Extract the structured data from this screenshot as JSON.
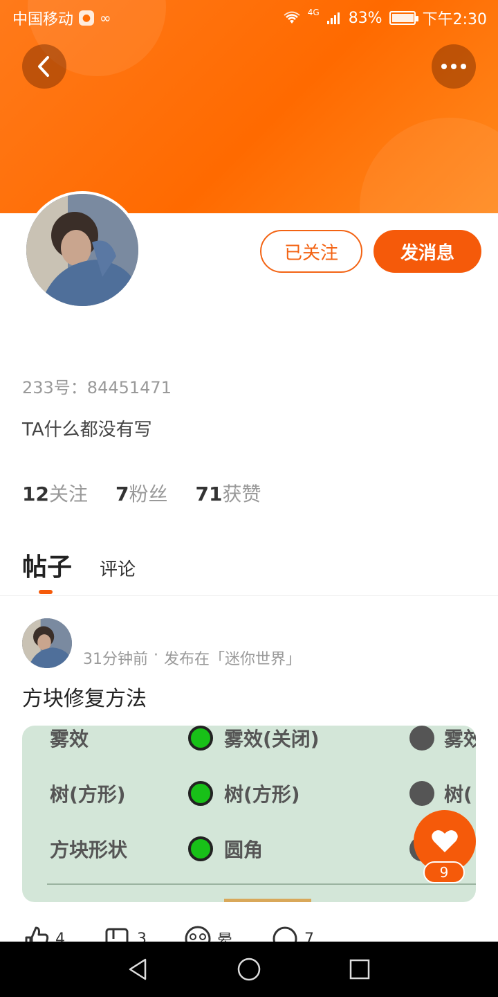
{
  "status_bar": {
    "carrier": "中国移动",
    "network": "4G",
    "battery": "83%",
    "time": "下午2:30",
    "battery_level": 0.83
  },
  "header": {
    "accent_color": "#ff6a00",
    "back_icon": "chevron-left-icon",
    "more_icon": "more-dots-icon"
  },
  "profile": {
    "follow_state_label": "已关注",
    "message_label": "发消息",
    "uid": "233号：84451471",
    "bio": "TA什么都没有写",
    "stats": [
      {
        "num": "12",
        "label": "关注"
      },
      {
        "num": "7",
        "label": "粉丝"
      },
      {
        "num": "71",
        "label": "获赞"
      }
    ]
  },
  "tabs": {
    "posts": "帖子",
    "comments": "评论"
  },
  "post": {
    "time": "31分钟前",
    "separator": "·",
    "location": "发布在「迷你世界」",
    "title": "方块修复方法",
    "image_rows": [
      {
        "label": "雾效",
        "value": "雾效(关闭)",
        "value2": "雾效"
      },
      {
        "label": "树(方形)",
        "value": "树(方形)",
        "value2": "树("
      },
      {
        "label": "方块形状",
        "value": "圆角",
        "value2": ""
      }
    ],
    "like_fab_count": "9",
    "actions": [
      {
        "icon": "thumbs-up-icon",
        "count": "4"
      },
      {
        "icon": "bookmark-icon",
        "count": "3"
      },
      {
        "icon": "dizzy-face-icon",
        "count": "晕"
      },
      {
        "icon": "comment-icon",
        "count": "7"
      }
    ]
  },
  "nav": {
    "back": "back-triangle-icon",
    "home": "home-circle-icon",
    "recents": "recents-square-icon"
  }
}
